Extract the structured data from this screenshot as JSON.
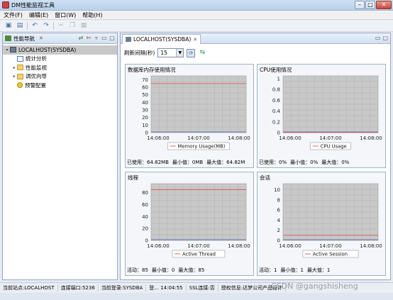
{
  "window": {
    "title": "DM性能监视工具",
    "controls": [
      "–",
      "□",
      "✕"
    ]
  },
  "menu": [
    "文件(F)",
    "编辑(E)",
    "窗口(W)",
    "帮助(H)"
  ],
  "nav": {
    "title": "性能导航",
    "tree": [
      {
        "label": "LOCALHOST(SYSDBA)",
        "icon": "server-icon",
        "expand": "▾",
        "level": 0,
        "selected": true
      },
      {
        "label": "统计分析",
        "icon": "stats-icon",
        "expand": "",
        "level": 1
      },
      {
        "label": "性能监视",
        "icon": "folder-icon",
        "expand": "▸",
        "level": 1
      },
      {
        "label": "调优向导",
        "icon": "folder-icon",
        "expand": "▸",
        "level": 1
      },
      {
        "label": "预警配置",
        "icon": "warning-icon",
        "expand": "",
        "level": 1
      }
    ]
  },
  "editor": {
    "tab": "LOCALHOST(SYSDBA)",
    "refresh_label": "刷新间隔(秒)",
    "refresh_value": "15"
  },
  "charts": {
    "memory": {
      "title": "数据库内存使用情况",
      "footer": [
        "已使用：64.82MB",
        "最小值：0MB",
        "最大值：64.82M"
      ]
    },
    "cpu": {
      "title": "CPU使用情况",
      "footer": [
        "已使用：0%",
        "最小值：0%",
        "最大值：0%"
      ]
    },
    "thread": {
      "title": "线程",
      "footer": [
        "活动：85",
        "最小值：0",
        "最大值：85"
      ]
    },
    "session": {
      "title": "会话",
      "footer": [
        "活动：1",
        "最小值：1",
        "最大值：1"
      ]
    }
  },
  "chart_data": [
    {
      "type": "line",
      "x": [
        "14:06:00",
        "14:07:00",
        "14:08:00"
      ],
      "yticks": [
        0,
        10,
        20,
        30,
        40,
        50,
        60,
        70
      ],
      "ylim": [
        0,
        75
      ],
      "series": [
        {
          "name": "Memory Usage(MB)",
          "values": [
            64.82,
            64.82,
            64.82
          ],
          "color": "#e05050"
        }
      ]
    },
    {
      "type": "line",
      "x": [
        "14:06:00",
        "14:07:00",
        "14:08:00"
      ],
      "yticks": [
        0,
        0.2,
        0.4,
        0.6,
        0.8,
        1
      ],
      "ylim": [
        0,
        1.05
      ],
      "series": [
        {
          "name": "CPU Usage",
          "values": [
            0,
            0,
            0
          ],
          "color": "#e05050"
        }
      ]
    },
    {
      "type": "line",
      "x": [
        "14:06:00",
        "14:07:00",
        "14:08:00"
      ],
      "yticks": [
        0,
        20,
        40,
        60,
        80
      ],
      "ylim": [
        0,
        95
      ],
      "series": [
        {
          "name": "Active Thread",
          "values": [
            85,
            85,
            85
          ],
          "color": "#e05050"
        }
      ]
    },
    {
      "type": "line",
      "x": [
        "14:06:00",
        "14:07:00",
        "14:08:00"
      ],
      "yticks": [
        0,
        2,
        4,
        6,
        8,
        10
      ],
      "ylim": [
        0,
        11.2
      ],
      "series": [
        {
          "name": "Active Session",
          "values": [
            1,
            1,
            1
          ],
          "color": "#e05050"
        }
      ]
    }
  ],
  "status": [
    "当前站点:LOCALHOST",
    "连接端口:5236",
    "当前登录:SYSDBA",
    "登...  14:04:55",
    "SSL连接:否",
    "授权信息:达梦公司产品设计"
  ],
  "watermark": "CSDN @gangshisheng"
}
